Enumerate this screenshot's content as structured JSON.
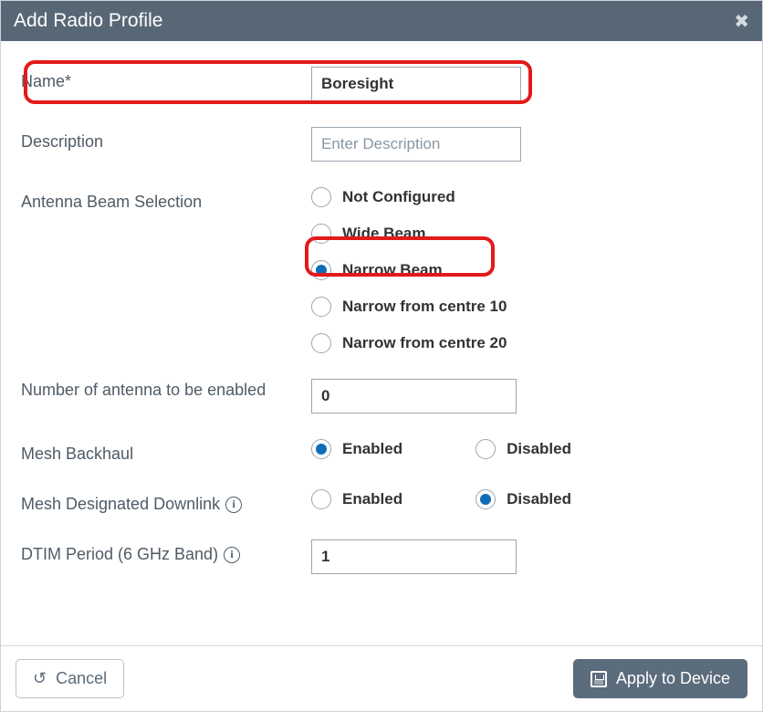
{
  "header": {
    "title": "Add Radio Profile"
  },
  "fields": {
    "name": {
      "label": "Name*",
      "value": "Boresight"
    },
    "description": {
      "label": "Description",
      "placeholder": "Enter Description",
      "value": ""
    },
    "antennaBeam": {
      "label": "Antenna Beam Selection",
      "options": [
        "Not Configured",
        "Wide Beam",
        "Narrow Beam",
        "Narrow from centre 10",
        "Narrow from centre 20"
      ],
      "selected": "Narrow Beam"
    },
    "antennaCount": {
      "label": "Number of antenna to be enabled",
      "value": "0"
    },
    "meshBackhaul": {
      "label": "Mesh Backhaul",
      "options": [
        "Enabled",
        "Disabled"
      ],
      "selected": "Enabled"
    },
    "meshDownlink": {
      "label": "Mesh Designated Downlink",
      "options": [
        "Enabled",
        "Disabled"
      ],
      "selected": "Disabled"
    },
    "dtim": {
      "label": "DTIM Period (6 GHz Band)",
      "value": "1"
    }
  },
  "footer": {
    "cancel": "Cancel",
    "apply": "Apply to Device"
  }
}
